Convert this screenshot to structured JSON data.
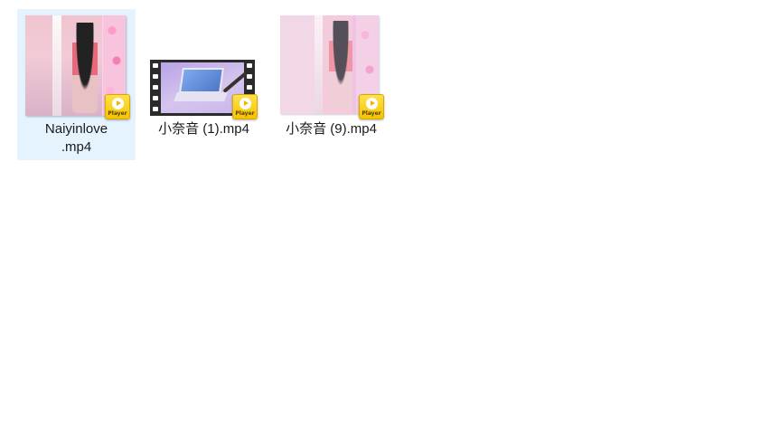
{
  "files": [
    {
      "name": "Naiyinlove\n.mp4",
      "selected": true,
      "badge": "Player"
    },
    {
      "name": "小奈音 (1).mp4",
      "selected": false,
      "badge": "Player"
    },
    {
      "name": "小奈音 (9).mp4",
      "selected": false,
      "badge": "Player"
    }
  ],
  "colors": {
    "selection": "#e5f3ff",
    "badge": "#f5c400"
  }
}
